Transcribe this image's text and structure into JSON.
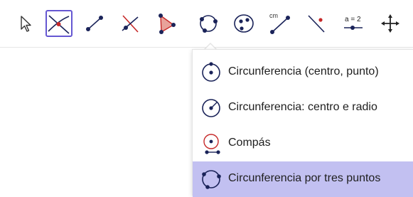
{
  "toolbar": {
    "tools": [
      {
        "name": "move",
        "icon": "cursor-arrow-icon"
      },
      {
        "name": "intersect",
        "icon": "intersect-icon"
      },
      {
        "name": "segment",
        "icon": "segment-icon"
      },
      {
        "name": "perpendicular-line",
        "icon": "perpendicular-line-icon"
      },
      {
        "name": "polygon",
        "icon": "polygon-icon"
      },
      {
        "name": "circle-through-three-points",
        "icon": "circle-three-points-icon"
      },
      {
        "name": "ellipse",
        "icon": "ellipse-icon"
      },
      {
        "name": "distance",
        "icon": "distance-icon",
        "label": "cm"
      },
      {
        "name": "reflect",
        "icon": "reflect-icon"
      },
      {
        "name": "slider",
        "icon": "slider-icon",
        "label": "a = 2"
      },
      {
        "name": "move-view",
        "icon": "move-arrows-icon"
      }
    ],
    "selected_tool": "intersect"
  },
  "submenu": {
    "items": [
      {
        "label": "Circunferencia (centro, punto)",
        "icon": "circle-center-point-icon"
      },
      {
        "label": "Circunferencia: centro e radio",
        "icon": "circle-center-radius-icon"
      },
      {
        "label": "Compás",
        "icon": "compass-icon"
      },
      {
        "label": "Circunferencia por tres puntos",
        "icon": "circle-three-points-icon"
      }
    ],
    "active_index": 3
  },
  "colors": {
    "selection_border": "#6557d2",
    "active_item_bg": "#c2c0f1",
    "point_dark": "#1a2359",
    "accent_red": "#c62828",
    "polygon_fill": "#e8a29a"
  }
}
